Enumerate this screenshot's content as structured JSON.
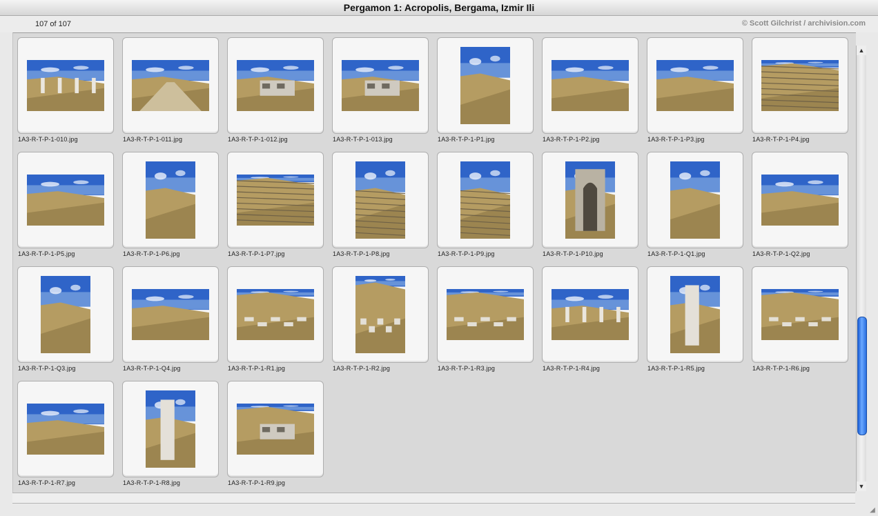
{
  "window": {
    "title": "Pergamon 1: Acropolis, Bergama, Izmir Ili"
  },
  "infobar": {
    "count": "107 of 107",
    "copyright": "© Scott Gilchrist / archivision.com"
  },
  "icons": {
    "scroll_up": "scroll-up-arrow-icon",
    "scroll_down": "scroll-down-arrow-icon",
    "resize": "resize-grip-icon"
  },
  "colors": {
    "sky": "#3b6fd0",
    "ground": "#b8a06a",
    "stone": "#d8d4cc",
    "scroll_accent": "#2a6fe0"
  },
  "scroll": {
    "position_fraction": 0.85
  },
  "thumbnails": [
    {
      "file": "1A3-R-T-P-1-010.jpg",
      "orient": "land",
      "kind": "columns"
    },
    {
      "file": "1A3-R-T-P-1-011.jpg",
      "orient": "land",
      "kind": "road"
    },
    {
      "file": "1A3-R-T-P-1-012.jpg",
      "orient": "land",
      "kind": "ruin"
    },
    {
      "file": "1A3-R-T-P-1-013.jpg",
      "orient": "land",
      "kind": "altar"
    },
    {
      "file": "1A3-R-T-P-1-P1.jpg",
      "orient": "port",
      "kind": "hill"
    },
    {
      "file": "1A3-R-T-P-1-P2.jpg",
      "orient": "land",
      "kind": "hill"
    },
    {
      "file": "1A3-R-T-P-1-P3.jpg",
      "orient": "land",
      "kind": "slope"
    },
    {
      "file": "1A3-R-T-P-1-P4.jpg",
      "orient": "land",
      "kind": "theatre"
    },
    {
      "file": "1A3-R-T-P-1-P5.jpg",
      "orient": "land",
      "kind": "slope"
    },
    {
      "file": "1A3-R-T-P-1-P6.jpg",
      "orient": "port",
      "kind": "hill"
    },
    {
      "file": "1A3-R-T-P-1-P7.jpg",
      "orient": "land",
      "kind": "theatre"
    },
    {
      "file": "1A3-R-T-P-1-P8.jpg",
      "orient": "port",
      "kind": "steps"
    },
    {
      "file": "1A3-R-T-P-1-P9.jpg",
      "orient": "port",
      "kind": "steps"
    },
    {
      "file": "1A3-R-T-P-1-P10.jpg",
      "orient": "port",
      "kind": "arch"
    },
    {
      "file": "1A3-R-T-P-1-Q1.jpg",
      "orient": "port",
      "kind": "slope"
    },
    {
      "file": "1A3-R-T-P-1-Q2.jpg",
      "orient": "land",
      "kind": "hill"
    },
    {
      "file": "1A3-R-T-P-1-Q3.jpg",
      "orient": "port",
      "kind": "hill"
    },
    {
      "file": "1A3-R-T-P-1-Q4.jpg",
      "orient": "land",
      "kind": "slope"
    },
    {
      "file": "1A3-R-T-P-1-R1.jpg",
      "orient": "land",
      "kind": "rubble"
    },
    {
      "file": "1A3-R-T-P-1-R2.jpg",
      "orient": "port",
      "kind": "rubble"
    },
    {
      "file": "1A3-R-T-P-1-R3.jpg",
      "orient": "land",
      "kind": "rubble"
    },
    {
      "file": "1A3-R-T-P-1-R4.jpg",
      "orient": "land",
      "kind": "columns"
    },
    {
      "file": "1A3-R-T-P-1-R5.jpg",
      "orient": "port",
      "kind": "stele"
    },
    {
      "file": "1A3-R-T-P-1-R6.jpg",
      "orient": "land",
      "kind": "rubble"
    },
    {
      "file": "1A3-R-T-P-1-R7.jpg",
      "orient": "land",
      "kind": "hill"
    },
    {
      "file": "1A3-R-T-P-1-R8.jpg",
      "orient": "port",
      "kind": "column"
    },
    {
      "file": "1A3-R-T-P-1-R9.jpg",
      "orient": "land",
      "kind": "block"
    }
  ]
}
